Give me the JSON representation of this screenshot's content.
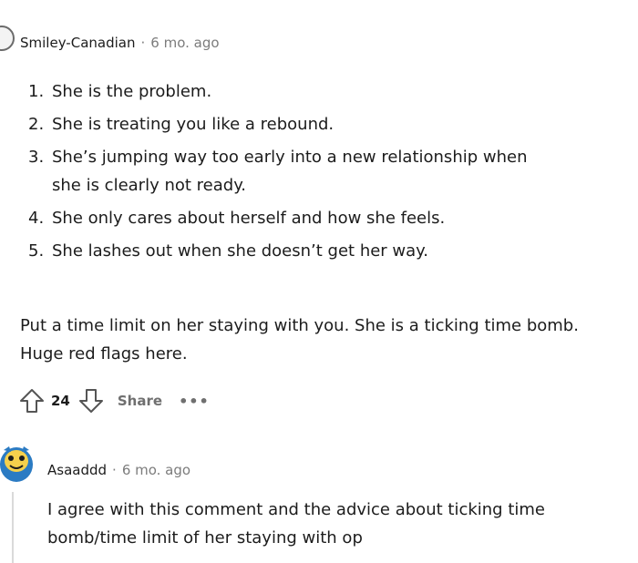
{
  "comment1": {
    "username": "Smiley-Canadian",
    "separator": "·",
    "time": "6 mo. ago",
    "points": [
      {
        "num": "1.",
        "text": "She is the problem."
      },
      {
        "num": "2.",
        "text": "She is treating you like a rebound."
      },
      {
        "num": "3.",
        "text": "She’s jumping way too early into a new relationship when she is clearly not ready."
      },
      {
        "num": "4.",
        "text": "She only cares about herself and how she feels."
      },
      {
        "num": "5.",
        "text": "She lashes out when she doesn’t get her way."
      }
    ],
    "paragraph": "Put a time limit on her staying with you. She is a ticking time bomb. Huge red flags here.",
    "upvotes": "24",
    "share_label": "Share",
    "more_label": "•••",
    "upvote_icon": "upvote-arrow-icon",
    "downvote_icon": "downvote-arrow-icon"
  },
  "comment2": {
    "username": "Asaaddd",
    "separator": "·",
    "time": "6 mo. ago",
    "text": "I agree with this comment and the advice about ticking time bomb/time limit of her staying with op",
    "avatar_colors": {
      "body": "#2b7bc3",
      "face": "#f5d04c"
    }
  }
}
